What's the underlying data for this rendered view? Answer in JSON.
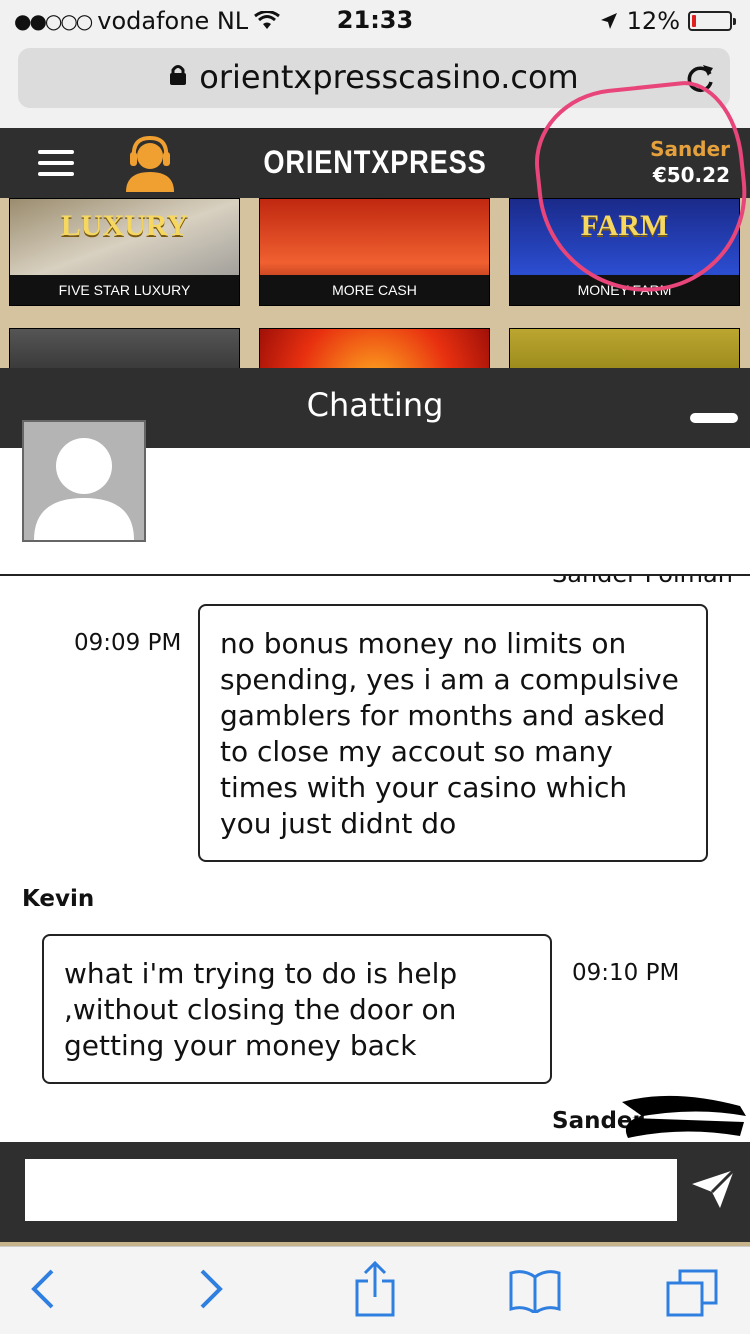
{
  "status": {
    "carrier": "vodafone NL",
    "time": "21:33",
    "battery": "12%",
    "battery_level": 0.12
  },
  "browser": {
    "url": "orientxpresscasino.com"
  },
  "site": {
    "logo": "ORIENTXPRESS",
    "user_name": "Sander",
    "balance": "€50.22"
  },
  "games": [
    {
      "label": "FIVE STAR LUXURY",
      "art_text": "LUXURY"
    },
    {
      "label": "MORE CASH",
      "art_text": ""
    },
    {
      "label": "MONEY FARM",
      "art_text": "FARM"
    }
  ],
  "chat": {
    "title": "Chatting",
    "partial_name": "Sander Polman",
    "messages": [
      {
        "time": "09:09 PM",
        "text": "no bonus money no limits on spending, yes i am a compulsive gamblers for months and asked to close my accout so many times with your casino which you just didnt do"
      },
      {
        "sender": "Kevin",
        "time": "09:10 PM",
        "text": "what i'm trying to do is help ,without closing the door on getting your money back"
      }
    ],
    "next_sender": "Sander",
    "input_placeholder": ""
  },
  "icons": {
    "signal": "signal-dots-icon",
    "wifi": "wifi-icon",
    "location": "location-arrow-icon",
    "lock": "lock-icon",
    "reload": "reload-icon",
    "menu": "hamburger-icon",
    "support": "support-agent-icon",
    "minimize": "minimize-icon",
    "send": "send-icon",
    "back": "back-icon",
    "forward": "forward-icon",
    "share": "share-icon",
    "bookmarks": "bookmarks-icon",
    "tabs": "tabs-icon"
  },
  "colors": {
    "header_bg": "#2f2f2f",
    "username": "#e4a03c",
    "annotation": "#e8457a",
    "ios_blue": "#2f7fe0"
  }
}
